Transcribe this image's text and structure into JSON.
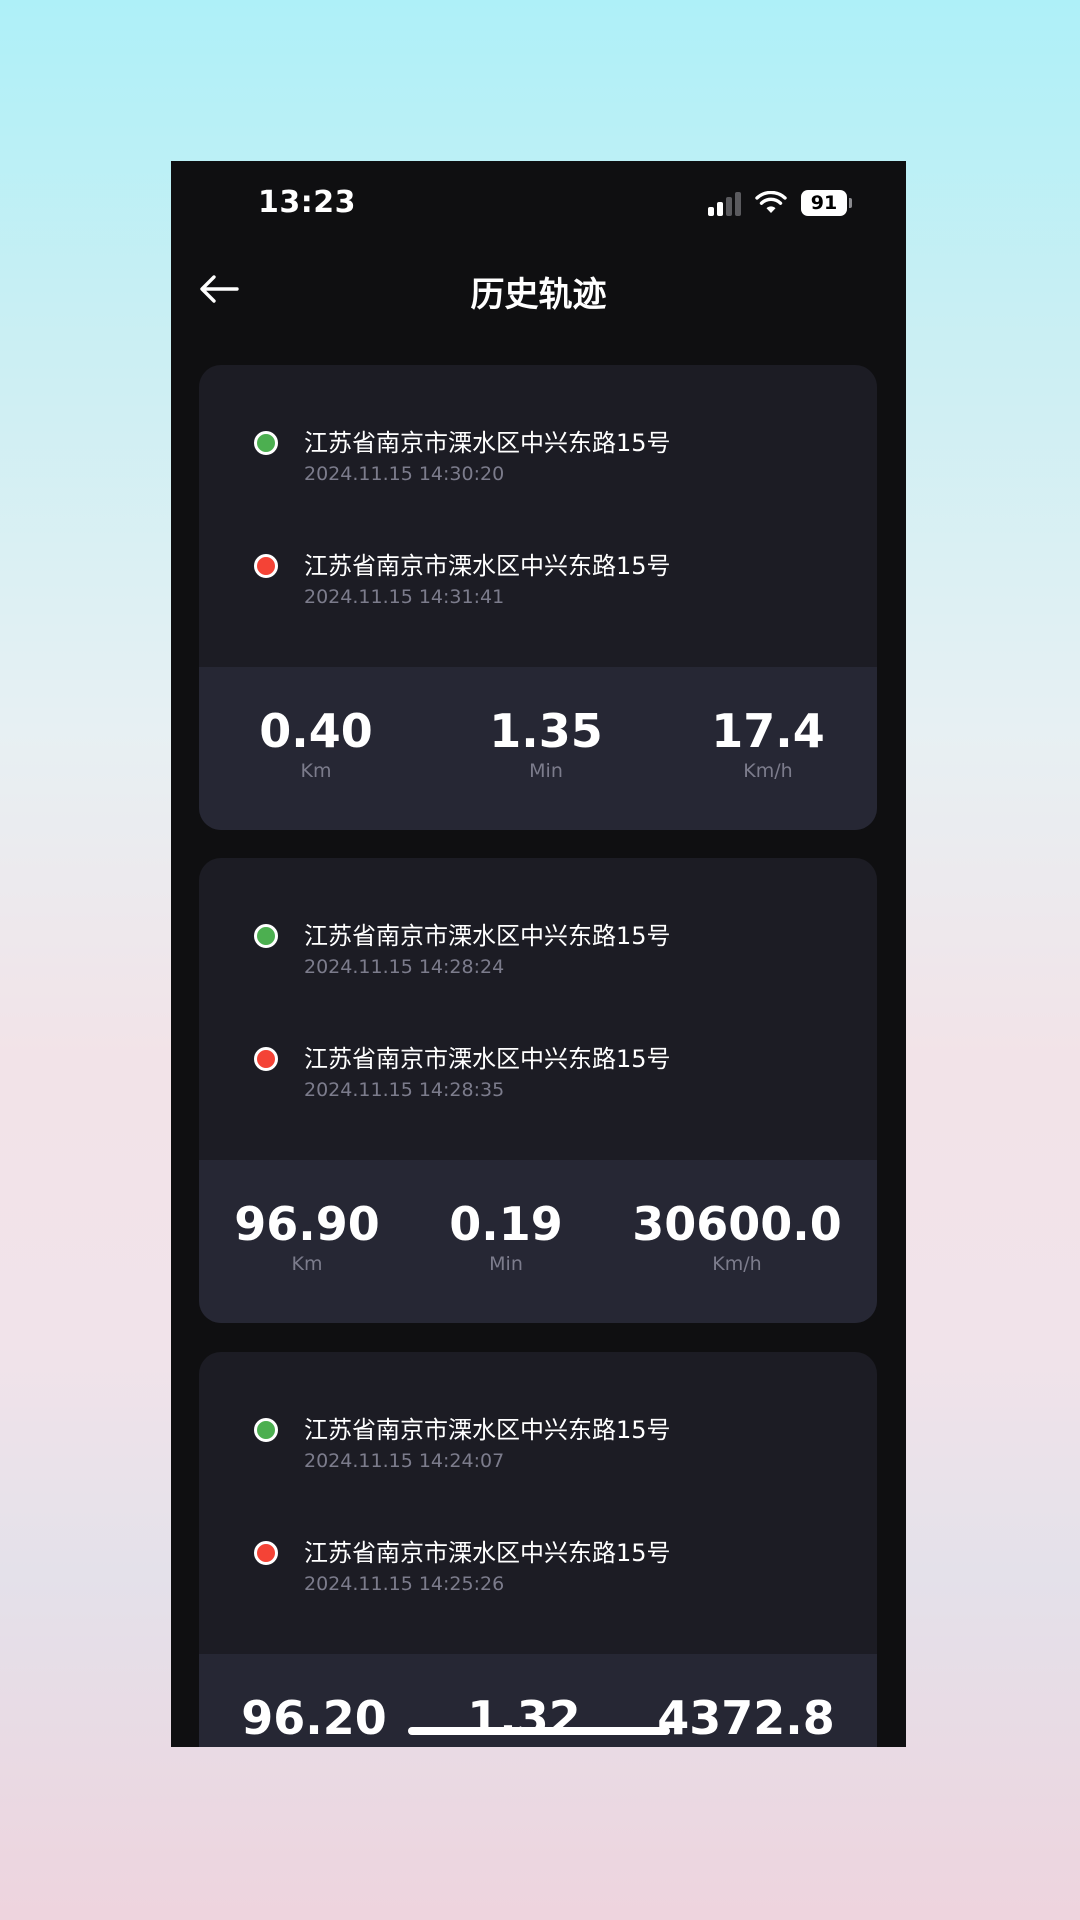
{
  "status_bar": {
    "time": "13:23",
    "battery": "91"
  },
  "header": {
    "title": "历史轨迹"
  },
  "trips": [
    {
      "start": {
        "address": "江苏省南京市溧水区中兴东路15号",
        "time": "2024.11.15 14:30:20"
      },
      "end": {
        "address": "江苏省南京市溧水区中兴东路15号",
        "time": "2024.11.15 14:31:41"
      },
      "stats": [
        {
          "value": "0.40",
          "unit": "Km"
        },
        {
          "value": "1.35",
          "unit": "Min"
        },
        {
          "value": "17.4",
          "unit": "Km/h"
        }
      ]
    },
    {
      "start": {
        "address": "江苏省南京市溧水区中兴东路15号",
        "time": "2024.11.15 14:28:24"
      },
      "end": {
        "address": "江苏省南京市溧水区中兴东路15号",
        "time": "2024.11.15 14:28:35"
      },
      "stats": [
        {
          "value": "96.90",
          "unit": "Km"
        },
        {
          "value": "0.19",
          "unit": "Min"
        },
        {
          "value": "30600.0",
          "unit": "Km/h"
        }
      ]
    },
    {
      "start": {
        "address": "江苏省南京市溧水区中兴东路15号",
        "time": "2024.11.15 14:24:07"
      },
      "end": {
        "address": "江苏省南京市溧水区中兴东路15号",
        "time": "2024.11.15 14:25:26"
      },
      "stats": [
        {
          "value": "96.20",
          "unit": ""
        },
        {
          "value": "1.32",
          "unit": ""
        },
        {
          "value": "4372.8",
          "unit": ""
        }
      ]
    }
  ]
}
